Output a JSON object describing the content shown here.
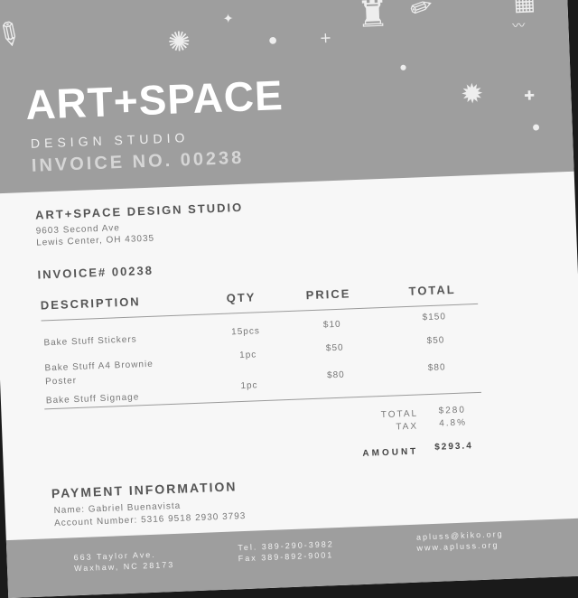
{
  "header": {
    "title": "ART+SPACE",
    "subtitle": "DESIGN STUDIO",
    "invoice_heading": "INVOICE NO. 00238"
  },
  "studio": {
    "name": "ART+SPACE DESIGN STUDIO",
    "address_line1": "9603 Second Ave",
    "address_line2": "Lewis Center, OH 43035"
  },
  "invoice_number": "INVOICE# 00238",
  "table": {
    "headers": {
      "description": "DESCRIPTION",
      "qty": "QTY",
      "price": "PRICE",
      "total": "TOTAL"
    },
    "rows": [
      {
        "description": "Bake Stuff Stickers",
        "qty": "15pcs",
        "price": "$10",
        "total": "$150"
      },
      {
        "description": "Bake Stuff A4 Brownie Poster",
        "qty": "1pc",
        "price": "$50",
        "total": "$50"
      },
      {
        "description": "Bake Stuff Signage",
        "qty": "1pc",
        "price": "$80",
        "total": "$80"
      }
    ]
  },
  "summary": {
    "total_label": "TOTAL",
    "total_value": "$280",
    "tax_label": "TAX",
    "tax_value": "4.8%",
    "amount_label": "AMOUNT",
    "amount_value": "$293.4"
  },
  "payment": {
    "title": "PAYMENT INFORMATION",
    "name_line": "Name: Gabriel Buenavista",
    "account_line": "Account Number: 5316 9518 2930 3793"
  },
  "footer": {
    "address_line1": "663 Taylor Ave.",
    "address_line2": "Waxhaw, NC 28173",
    "tel": "Tel. 389-290-3982",
    "fax": "Fax 389-892-9001",
    "email": "apluss@kiko.org",
    "website": "www.apluss.org"
  },
  "colors": {
    "header_bg": "#9e9e9e",
    "paper": "#f7f7f7",
    "text": "#555555"
  },
  "decorations": [
    "brush-icon",
    "sun-icon",
    "sparkle-icon",
    "pencil-icon",
    "paint-tube-icon",
    "palette-icon"
  ]
}
